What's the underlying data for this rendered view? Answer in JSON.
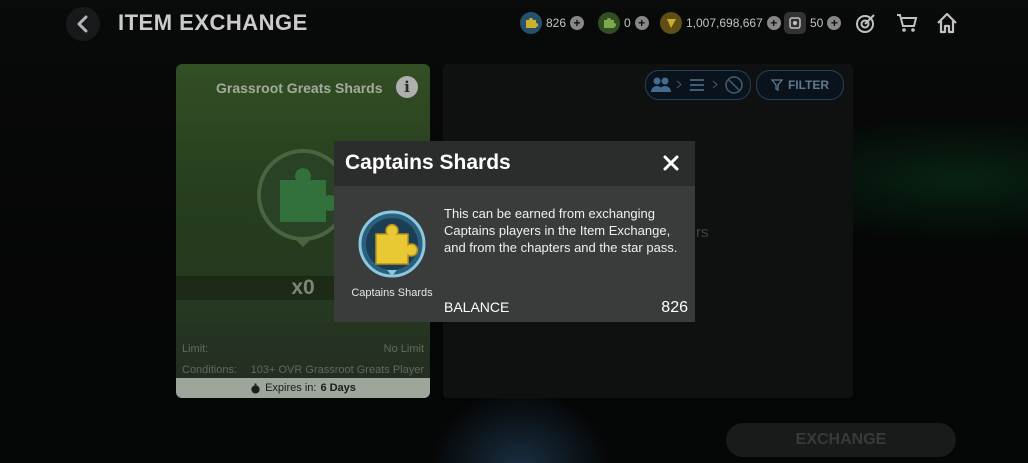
{
  "header": {
    "title": "ITEM EXCHANGE",
    "currencies": [
      {
        "icon": "captains-shard-icon",
        "value": "826"
      },
      {
        "icon": "green-shard-icon",
        "value": "0"
      },
      {
        "icon": "coins-icon",
        "value": "1,007,698,667"
      },
      {
        "icon": "tickets-icon",
        "value": "50"
      }
    ]
  },
  "card": {
    "title": "Grassroot Greats Shards",
    "count": "x0",
    "limit_label": "Limit:",
    "limit_value": "No Limit",
    "conditions_label": "Conditions:",
    "conditions_value": "103+ OVR Grassroot Greats Player",
    "expires_label": "Expires in:",
    "expires_value": "6 Days"
  },
  "panel": {
    "filter_label": "FILTER",
    "partial_text": "rs"
  },
  "exchange_label": "EXCHANGE",
  "modal": {
    "title": "Captains Shards",
    "item_name": "Captains Shards",
    "description": "This can be earned from exchanging Captains players in the Item Exchange, and from the chapters and the star pass.",
    "balance_label": "BALANCE",
    "balance_value": "826"
  },
  "colors": {
    "modal_bg": "#3a3b3b",
    "modal_header": "#2b2c2c",
    "shard_gold": "#e8c933",
    "shard_ring": "#5aa7c7"
  }
}
